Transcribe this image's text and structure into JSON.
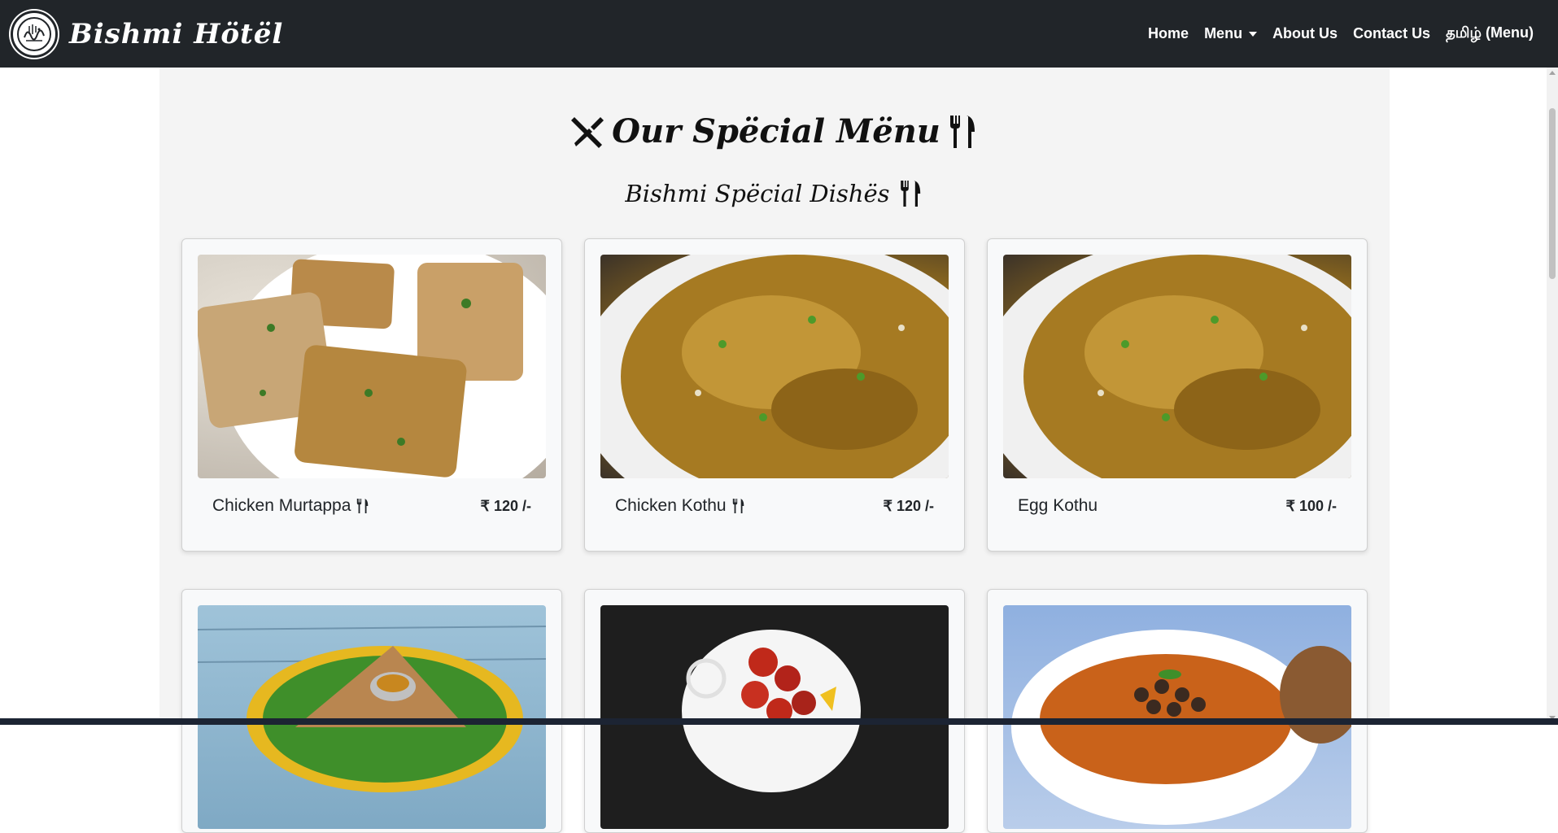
{
  "brand": {
    "name": "Bishmi Hötël",
    "logo_icon": "bismillah-calligraphy-logo"
  },
  "nav": {
    "items": [
      {
        "label": "Home"
      },
      {
        "label": "Menu",
        "has_dropdown": true
      },
      {
        "label": "About Us"
      },
      {
        "label": "Contact Us"
      },
      {
        "label": "தமிழ் (Menu)"
      }
    ]
  },
  "section": {
    "title": "Our Spëcial Mënu",
    "title_icons": [
      "utensils-crossed-icon",
      "fork-knife-icon"
    ],
    "subtitle": "Bishmi Spëcial Dishës",
    "subtitle_icon": "fork-knife-icon"
  },
  "dishes": [
    {
      "name": "Chicken Murtappa",
      "price": "₹ 120 /-",
      "has_icon": true,
      "image": "chicken-murtappa"
    },
    {
      "name": "Chicken Kothu",
      "price": "₹ 120 /-",
      "has_icon": true,
      "image": "chicken-kothu"
    },
    {
      "name": "Egg Kothu",
      "price": "₹ 100 /-",
      "has_icon": false,
      "image": "egg-kothu"
    },
    {
      "name": "",
      "price": "",
      "has_icon": false,
      "image": "dosa-on-banana-leaf"
    },
    {
      "name": "",
      "price": "",
      "has_icon": false,
      "image": "chilli-chicken"
    },
    {
      "name": "",
      "price": "",
      "has_icon": false,
      "image": "chana-curry"
    }
  ],
  "colors": {
    "navbar_bg": "#212529",
    "page_bg": "#f4f4f4",
    "card_bg": "#f8f9fa"
  }
}
